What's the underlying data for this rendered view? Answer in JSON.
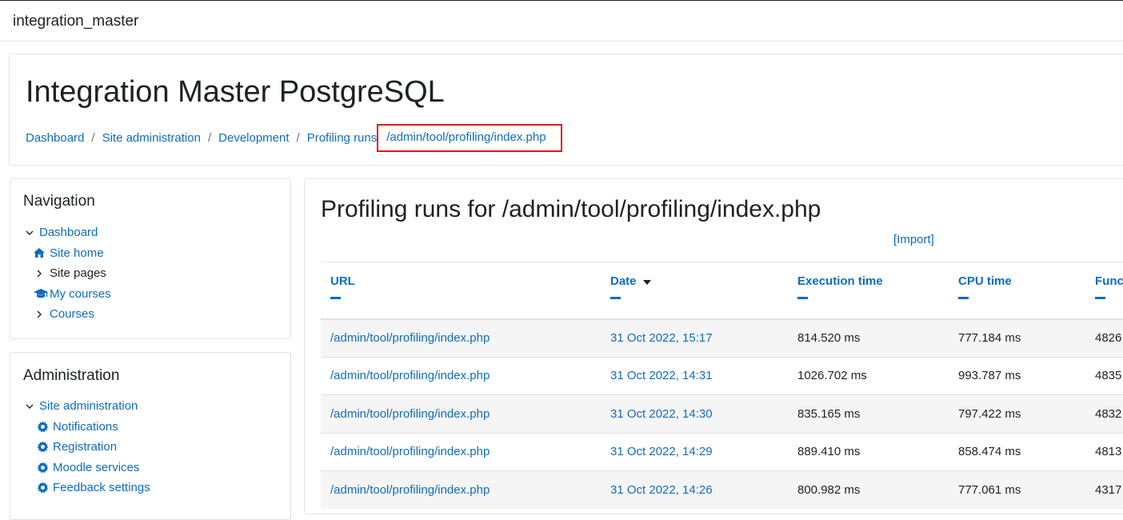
{
  "site": {
    "brand": "integration_master"
  },
  "header": {
    "title": "Integration Master PostgreSQL",
    "breadcrumb": [
      "Dashboard",
      "Site administration",
      "Development",
      "Profiling runs"
    ],
    "breadcrumb_current": "/admin/tool/profiling/index.php"
  },
  "navigation": {
    "title": "Navigation",
    "items": [
      {
        "label": "Dashboard",
        "icon": "chevron-down-icon"
      },
      {
        "label": "Site home",
        "icon": "home-icon"
      },
      {
        "label": "Site pages",
        "icon": "chevron-right-icon"
      },
      {
        "label": "My courses",
        "icon": "graduation-cap-icon"
      },
      {
        "label": "Courses",
        "icon": "chevron-right-icon"
      }
    ]
  },
  "administration": {
    "title": "Administration",
    "items": [
      {
        "label": "Site administration",
        "icon": "chevron-down-icon"
      },
      {
        "label": "Notifications",
        "icon": "gear-icon"
      },
      {
        "label": "Registration",
        "icon": "gear-icon"
      },
      {
        "label": "Moodle services",
        "icon": "gear-icon"
      },
      {
        "label": "Feedback settings",
        "icon": "gear-icon"
      }
    ]
  },
  "main": {
    "title": "Profiling runs for /admin/tool/profiling/index.php",
    "import_label": "[Import]",
    "columns": [
      "URL",
      "Date",
      "Execution time",
      "CPU time",
      "Func"
    ],
    "rows": [
      {
        "url": "/admin/tool/profiling/index.php",
        "date": "31 Oct 2022, 15:17",
        "exec": "814.520 ms",
        "cpu": "777.184 ms",
        "func": "4826"
      },
      {
        "url": "/admin/tool/profiling/index.php",
        "date": "31 Oct 2022, 14:31",
        "exec": "1026.702 ms",
        "cpu": "993.787 ms",
        "func": "4835"
      },
      {
        "url": "/admin/tool/profiling/index.php",
        "date": "31 Oct 2022, 14:30",
        "exec": "835.165 ms",
        "cpu": "797.422 ms",
        "func": "4832"
      },
      {
        "url": "/admin/tool/profiling/index.php",
        "date": "31 Oct 2022, 14:29",
        "exec": "889.410 ms",
        "cpu": "858.474 ms",
        "func": "4813"
      },
      {
        "url": "/admin/tool/profiling/index.php",
        "date": "31 Oct 2022, 14:26",
        "exec": "800.982 ms",
        "cpu": "777.061 ms",
        "func": "4317"
      }
    ]
  },
  "colors": {
    "link": "#0f6cbf",
    "highlight_box": "#e8141b",
    "text": "#1d2125",
    "border": "#dee2e6"
  }
}
